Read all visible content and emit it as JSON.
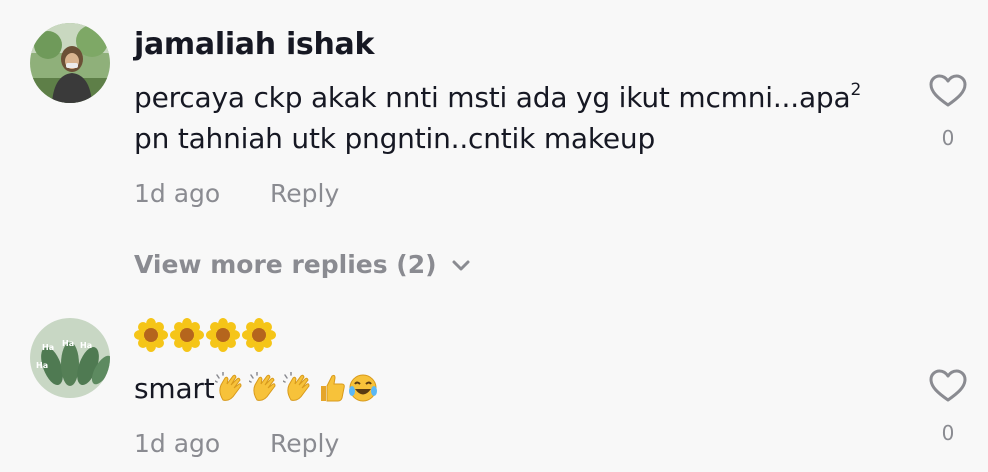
{
  "comments": [
    {
      "username": "jamaliah ishak",
      "text_line_1": "percaya ckp akak nnti msti ada yg ikut mcmni...apa",
      "text_sup": "2",
      "text_line_2": "pn tahniah utk pngntin..cntik makeup",
      "time": "1d ago",
      "reply_label": "Reply",
      "like_count": "0",
      "view_more": "View more replies (2)"
    },
    {
      "username": "",
      "text_emojis_top": [
        "sunflower-icon",
        "sunflower-icon",
        "sunflower-icon",
        "sunflower-icon"
      ],
      "text": "smart",
      "text_emojis_inline": [
        "clapping-hands-icon",
        "clapping-hands-icon",
        "clapping-hands-icon",
        "thumbs-up-icon",
        "tears-of-joy-icon"
      ],
      "time": "1d ago",
      "reply_label": "Reply",
      "like_count": "0"
    }
  ],
  "colors": {
    "background": "#f8f8f8",
    "primary_text": "#161823",
    "secondary_text": "#8a8b91",
    "heart_outline": "#8a8b91"
  }
}
